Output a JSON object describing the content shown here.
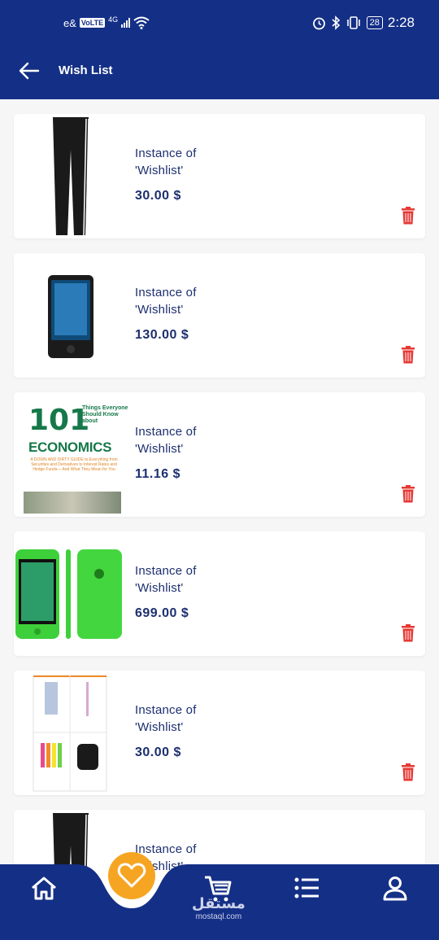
{
  "status_bar": {
    "carrier": "e&",
    "volte": "VoLTE",
    "network": "4G",
    "battery": "28",
    "time": "2:28"
  },
  "header": {
    "title": "Wish List"
  },
  "wishlist": {
    "items": [
      {
        "name_line1": "Instance of",
        "name_line2": "'Wishlist'",
        "price": "30.00 $",
        "image": "track-pants"
      },
      {
        "name_line1": "Instance of",
        "name_line2": "'Wishlist'",
        "price": "130.00 $",
        "image": "media-player"
      },
      {
        "name_line1": "Instance of",
        "name_line2": "'Wishlist'",
        "price": "11.16 $",
        "image": "book-cover"
      },
      {
        "name_line1": "Instance of",
        "name_line2": "'Wishlist'",
        "price": "699.00 $",
        "image": "green-phone"
      },
      {
        "name_line1": "Instance of",
        "name_line2": "'Wishlist'",
        "price": "30.00 $",
        "image": "stationery-grid"
      },
      {
        "name_line1": "Instance of",
        "name_line2": "'Wishlist'",
        "price": "",
        "image": "track-pants"
      }
    ]
  },
  "book": {
    "number": "101",
    "subtitle": "Things Everyone Should Know about",
    "topic": "ECONOMICS",
    "tagline": "A DOWN AND DIRTY GUIDE to Everything from Securities and Derivatives to Interest Rates and Hedge Funds— And What They Mean for You"
  },
  "nav": {
    "items": [
      "home-icon",
      "heart-icon",
      "cart-icon",
      "list-icon",
      "user-icon"
    ],
    "active": "heart-icon"
  },
  "watermark": {
    "line1": "مستقل",
    "line2": "mostaql.com"
  },
  "colors": {
    "primary": "#142f86",
    "accent": "#f6a523",
    "trash": "#e53935",
    "text": "#1c2f6f"
  }
}
